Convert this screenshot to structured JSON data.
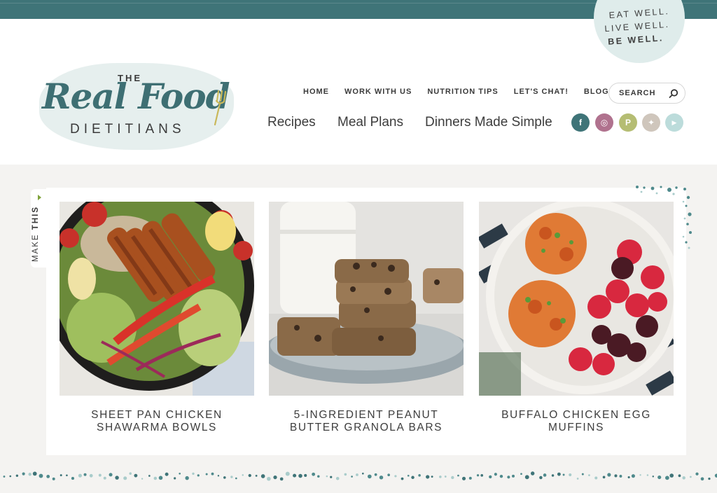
{
  "brand": {
    "logo_the": "THE",
    "logo_main": "Real Food",
    "logo_sub": "DIETITIANS",
    "tagline": [
      "EAT WELL.",
      "LIVE WELL.",
      "BE WELL."
    ],
    "accent_color": "#3f7478"
  },
  "nav_top": [
    "HOME",
    "WORK WITH US",
    "NUTRITION TIPS",
    "LET'S CHAT!",
    "BLOG"
  ],
  "search": {
    "placeholder": "SEARCH",
    "icon": "search-icon"
  },
  "nav_main": [
    "Recipes",
    "Meal Plans",
    "Dinners Made Simple"
  ],
  "social": [
    {
      "name": "facebook-icon",
      "glyph": "f",
      "color": "#3f7478"
    },
    {
      "name": "instagram-icon",
      "glyph": "◎",
      "color": "#b0728e"
    },
    {
      "name": "pinterest-icon",
      "glyph": "P",
      "color": "#b5bd73"
    },
    {
      "name": "twitter-icon",
      "glyph": "✦",
      "color": "#cfc6bc"
    },
    {
      "name": "youtube-icon",
      "glyph": "▶",
      "color": "#bcdcdb"
    }
  ],
  "make_this": {
    "prefix": "MAKE",
    "bold": "THIS"
  },
  "recipes": [
    {
      "title_line1": "SHEET PAN CHICKEN",
      "title_line2": "SHAWARMA BOWLS"
    },
    {
      "title_line1": "5-INGREDIENT PEANUT",
      "title_line2": "BUTTER GRANOLA BARS"
    },
    {
      "title_line1": "BUFFALO CHICKEN EGG",
      "title_line2": "MUFFINS"
    }
  ]
}
